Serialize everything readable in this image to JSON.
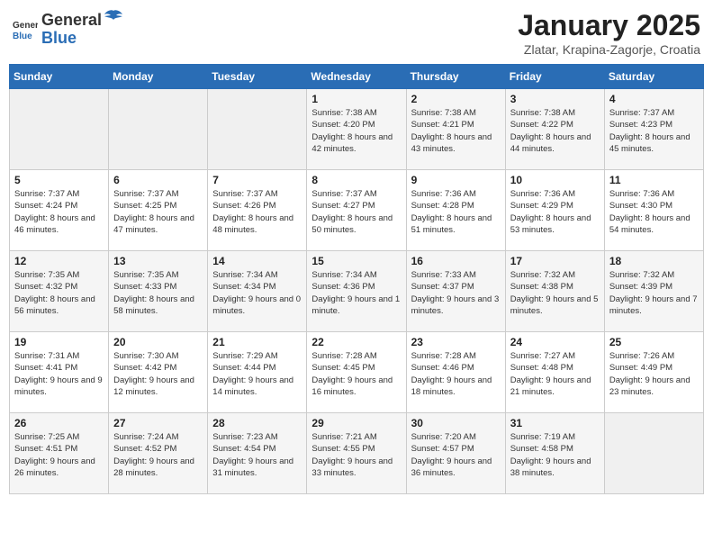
{
  "header": {
    "logo_general": "General",
    "logo_blue": "Blue",
    "title": "January 2025",
    "location": "Zlatar, Krapina-Zagorje, Croatia"
  },
  "weekdays": [
    "Sunday",
    "Monday",
    "Tuesday",
    "Wednesday",
    "Thursday",
    "Friday",
    "Saturday"
  ],
  "weeks": [
    [
      {
        "day": "",
        "info": ""
      },
      {
        "day": "",
        "info": ""
      },
      {
        "day": "",
        "info": ""
      },
      {
        "day": "1",
        "info": "Sunrise: 7:38 AM\nSunset: 4:20 PM\nDaylight: 8 hours and 42 minutes."
      },
      {
        "day": "2",
        "info": "Sunrise: 7:38 AM\nSunset: 4:21 PM\nDaylight: 8 hours and 43 minutes."
      },
      {
        "day": "3",
        "info": "Sunrise: 7:38 AM\nSunset: 4:22 PM\nDaylight: 8 hours and 44 minutes."
      },
      {
        "day": "4",
        "info": "Sunrise: 7:37 AM\nSunset: 4:23 PM\nDaylight: 8 hours and 45 minutes."
      }
    ],
    [
      {
        "day": "5",
        "info": "Sunrise: 7:37 AM\nSunset: 4:24 PM\nDaylight: 8 hours and 46 minutes."
      },
      {
        "day": "6",
        "info": "Sunrise: 7:37 AM\nSunset: 4:25 PM\nDaylight: 8 hours and 47 minutes."
      },
      {
        "day": "7",
        "info": "Sunrise: 7:37 AM\nSunset: 4:26 PM\nDaylight: 8 hours and 48 minutes."
      },
      {
        "day": "8",
        "info": "Sunrise: 7:37 AM\nSunset: 4:27 PM\nDaylight: 8 hours and 50 minutes."
      },
      {
        "day": "9",
        "info": "Sunrise: 7:36 AM\nSunset: 4:28 PM\nDaylight: 8 hours and 51 minutes."
      },
      {
        "day": "10",
        "info": "Sunrise: 7:36 AM\nSunset: 4:29 PM\nDaylight: 8 hours and 53 minutes."
      },
      {
        "day": "11",
        "info": "Sunrise: 7:36 AM\nSunset: 4:30 PM\nDaylight: 8 hours and 54 minutes."
      }
    ],
    [
      {
        "day": "12",
        "info": "Sunrise: 7:35 AM\nSunset: 4:32 PM\nDaylight: 8 hours and 56 minutes."
      },
      {
        "day": "13",
        "info": "Sunrise: 7:35 AM\nSunset: 4:33 PM\nDaylight: 8 hours and 58 minutes."
      },
      {
        "day": "14",
        "info": "Sunrise: 7:34 AM\nSunset: 4:34 PM\nDaylight: 9 hours and 0 minutes."
      },
      {
        "day": "15",
        "info": "Sunrise: 7:34 AM\nSunset: 4:36 PM\nDaylight: 9 hours and 1 minute."
      },
      {
        "day": "16",
        "info": "Sunrise: 7:33 AM\nSunset: 4:37 PM\nDaylight: 9 hours and 3 minutes."
      },
      {
        "day": "17",
        "info": "Sunrise: 7:32 AM\nSunset: 4:38 PM\nDaylight: 9 hours and 5 minutes."
      },
      {
        "day": "18",
        "info": "Sunrise: 7:32 AM\nSunset: 4:39 PM\nDaylight: 9 hours and 7 minutes."
      }
    ],
    [
      {
        "day": "19",
        "info": "Sunrise: 7:31 AM\nSunset: 4:41 PM\nDaylight: 9 hours and 9 minutes."
      },
      {
        "day": "20",
        "info": "Sunrise: 7:30 AM\nSunset: 4:42 PM\nDaylight: 9 hours and 12 minutes."
      },
      {
        "day": "21",
        "info": "Sunrise: 7:29 AM\nSunset: 4:44 PM\nDaylight: 9 hours and 14 minutes."
      },
      {
        "day": "22",
        "info": "Sunrise: 7:28 AM\nSunset: 4:45 PM\nDaylight: 9 hours and 16 minutes."
      },
      {
        "day": "23",
        "info": "Sunrise: 7:28 AM\nSunset: 4:46 PM\nDaylight: 9 hours and 18 minutes."
      },
      {
        "day": "24",
        "info": "Sunrise: 7:27 AM\nSunset: 4:48 PM\nDaylight: 9 hours and 21 minutes."
      },
      {
        "day": "25",
        "info": "Sunrise: 7:26 AM\nSunset: 4:49 PM\nDaylight: 9 hours and 23 minutes."
      }
    ],
    [
      {
        "day": "26",
        "info": "Sunrise: 7:25 AM\nSunset: 4:51 PM\nDaylight: 9 hours and 26 minutes."
      },
      {
        "day": "27",
        "info": "Sunrise: 7:24 AM\nSunset: 4:52 PM\nDaylight: 9 hours and 28 minutes."
      },
      {
        "day": "28",
        "info": "Sunrise: 7:23 AM\nSunset: 4:54 PM\nDaylight: 9 hours and 31 minutes."
      },
      {
        "day": "29",
        "info": "Sunrise: 7:21 AM\nSunset: 4:55 PM\nDaylight: 9 hours and 33 minutes."
      },
      {
        "day": "30",
        "info": "Sunrise: 7:20 AM\nSunset: 4:57 PM\nDaylight: 9 hours and 36 minutes."
      },
      {
        "day": "31",
        "info": "Sunrise: 7:19 AM\nSunset: 4:58 PM\nDaylight: 9 hours and 38 minutes."
      },
      {
        "day": "",
        "info": ""
      }
    ]
  ]
}
